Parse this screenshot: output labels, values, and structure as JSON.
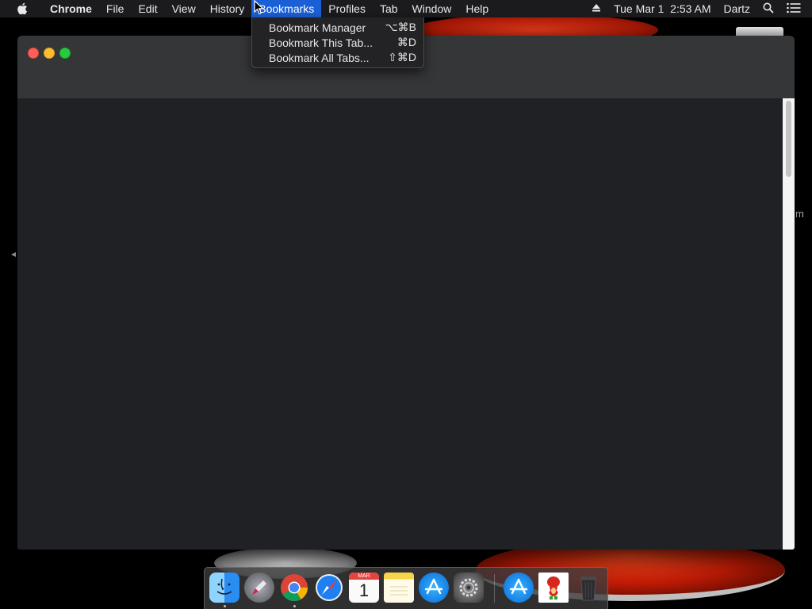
{
  "menubar": {
    "apple_icon": "apple-icon",
    "app_name": "Chrome",
    "menus": [
      "File",
      "Edit",
      "View",
      "History",
      "Bookmarks",
      "Profiles",
      "Tab",
      "Window",
      "Help"
    ],
    "active_menu": "Bookmarks",
    "status": {
      "eject_icon": "eject-icon",
      "datetime": "Tue Mar 1  2:53 AM",
      "user": "Dartz",
      "search_icon": "spotlight-search-icon",
      "notification_icon": "notification-center-icon"
    }
  },
  "bookmarks_menu": {
    "items": [
      {
        "label": "Bookmark Manager",
        "shortcut": "⌥⌘B"
      },
      {
        "label": "Bookmark This Tab...",
        "shortcut": "⌘D"
      },
      {
        "label": "Bookmark All Tabs...",
        "shortcut": "⇧⌘D"
      }
    ]
  },
  "desktop": {
    "label_fragment": "m"
  },
  "dock": {
    "apps": [
      {
        "name": "Finder",
        "icon": "finder-icon",
        "running": true
      },
      {
        "name": "Launchpad",
        "icon": "launchpad-icon",
        "running": false
      },
      {
        "name": "Google Chrome",
        "icon": "chrome-icon",
        "running": true
      },
      {
        "name": "Safari",
        "icon": "safari-icon",
        "running": false
      },
      {
        "name": "Calendar",
        "icon": "calendar-icon",
        "running": false,
        "month": "MAR",
        "day": "1"
      },
      {
        "name": "Notes",
        "icon": "notes-icon",
        "running": false
      },
      {
        "name": "App Store",
        "icon": "app-store-icon",
        "running": false
      },
      {
        "name": "System Preferences",
        "icon": "system-preferences-icon",
        "running": false
      },
      {
        "name": "App Store Downloads",
        "icon": "app-store-folder-icon",
        "running": false
      },
      {
        "name": "Knuckles",
        "icon": "knuckles-icon",
        "running": false
      },
      {
        "name": "Trash",
        "icon": "trash-icon",
        "running": false
      }
    ]
  },
  "colors": {
    "menu_highlight": "#1a5fd6",
    "window_bg": "#202124",
    "titlebar_bg": "#353638"
  }
}
